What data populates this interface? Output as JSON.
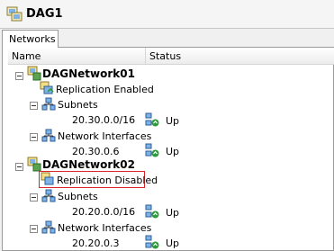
{
  "window": {
    "title": "DAG1"
  },
  "tabs": [
    {
      "label": "Networks"
    }
  ],
  "columns": {
    "name": "Name",
    "status": "Status"
  },
  "tree": {
    "network1": {
      "name": "DAGNetwork01",
      "replication": "Replication Enabled",
      "subnets_label": "Subnets",
      "subnet": {
        "value": "20.30.0.0/16",
        "status": "Up"
      },
      "interfaces_label": "Network Interfaces",
      "interface": {
        "value": "20.30.0.6",
        "status": "Up"
      }
    },
    "network2": {
      "name": "DAGNetwork02",
      "replication": "Replication Disabled",
      "subnets_label": "Subnets",
      "subnet": {
        "value": "20.20.0.0/16",
        "status": "Up"
      },
      "interfaces_label": "Network Interfaces",
      "interface": {
        "value": "20.20.0.3",
        "status": "Up"
      }
    }
  },
  "icons": {
    "title": "dag-icon",
    "network": "network-icon",
    "replication": "replication-icon",
    "subnets": "subnets-icon",
    "interfaces": "network-interfaces-icon",
    "status": "status-up-icon"
  },
  "colors": {
    "highlight": "#d9262b",
    "status_up": "#2e9b3b"
  }
}
